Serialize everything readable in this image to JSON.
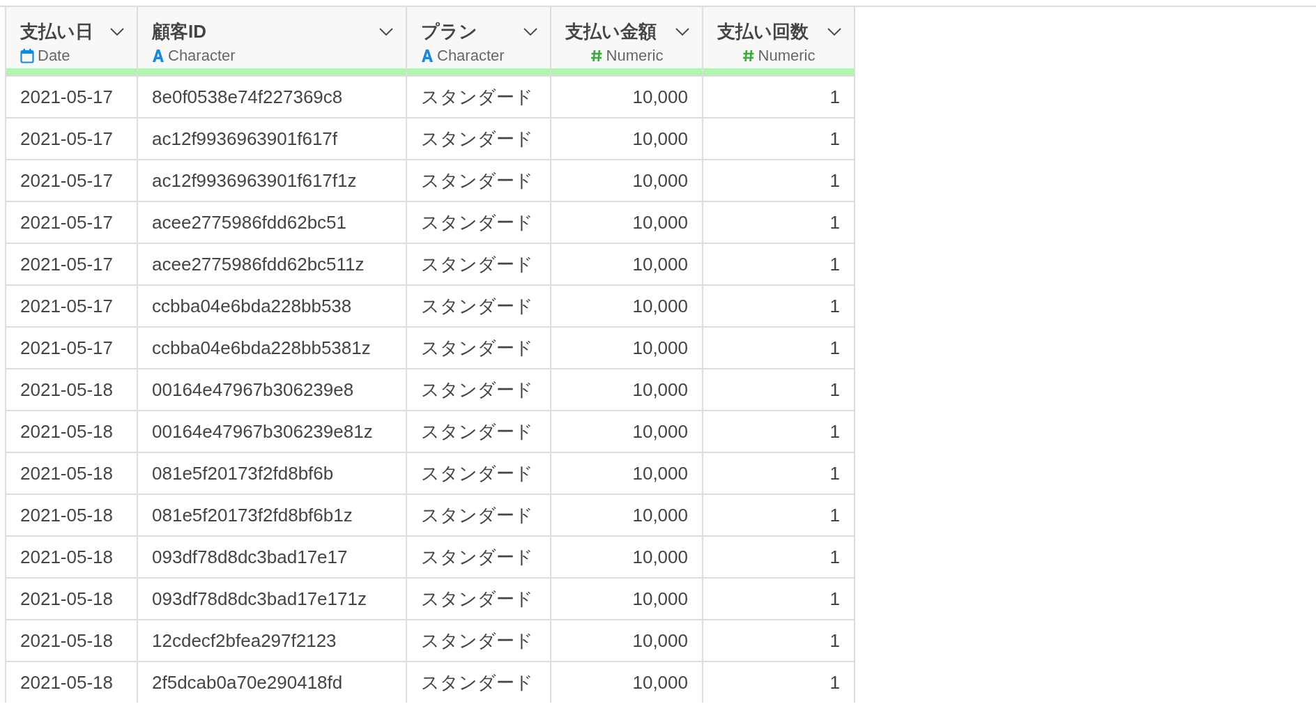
{
  "table": {
    "columns": [
      {
        "title": "支払い日",
        "type_label": "Date",
        "kind": "date"
      },
      {
        "title": "顧客ID",
        "type_label": "Character",
        "kind": "character"
      },
      {
        "title": "プラン",
        "type_label": "Character",
        "kind": "character"
      },
      {
        "title": "支払い金額",
        "type_label": "Numeric",
        "kind": "numeric"
      },
      {
        "title": "支払い回数",
        "type_label": "Numeric",
        "kind": "numeric"
      }
    ],
    "rows": [
      [
        "2021-05-17",
        "8e0f0538e74f227369c8",
        "スタンダード",
        "10,000",
        "1"
      ],
      [
        "2021-05-17",
        "ac12f9936963901f617f",
        "スタンダード",
        "10,000",
        "1"
      ],
      [
        "2021-05-17",
        "ac12f9936963901f617f1z",
        "スタンダード",
        "10,000",
        "1"
      ],
      [
        "2021-05-17",
        "acee2775986fdd62bc51",
        "スタンダード",
        "10,000",
        "1"
      ],
      [
        "2021-05-17",
        "acee2775986fdd62bc511z",
        "スタンダード",
        "10,000",
        "1"
      ],
      [
        "2021-05-17",
        "ccbba04e6bda228bb538",
        "スタンダード",
        "10,000",
        "1"
      ],
      [
        "2021-05-17",
        "ccbba04e6bda228bb5381z",
        "スタンダード",
        "10,000",
        "1"
      ],
      [
        "2021-05-18",
        "00164e47967b306239e8",
        "スタンダード",
        "10,000",
        "1"
      ],
      [
        "2021-05-18",
        "00164e47967b306239e81z",
        "スタンダード",
        "10,000",
        "1"
      ],
      [
        "2021-05-18",
        "081e5f20173f2fd8bf6b",
        "スタンダード",
        "10,000",
        "1"
      ],
      [
        "2021-05-18",
        "081e5f20173f2fd8bf6b1z",
        "スタンダード",
        "10,000",
        "1"
      ],
      [
        "2021-05-18",
        "093df78d8dc3bad17e17",
        "スタンダード",
        "10,000",
        "1"
      ],
      [
        "2021-05-18",
        "093df78d8dc3bad17e171z",
        "スタンダード",
        "10,000",
        "1"
      ],
      [
        "2021-05-18",
        "12cdecf2bfea297f2123",
        "スタンダード",
        "10,000",
        "1"
      ],
      [
        "2021-05-18",
        "2f5dcab0a70e290418fd",
        "スタンダード",
        "10,000",
        "1"
      ]
    ]
  }
}
